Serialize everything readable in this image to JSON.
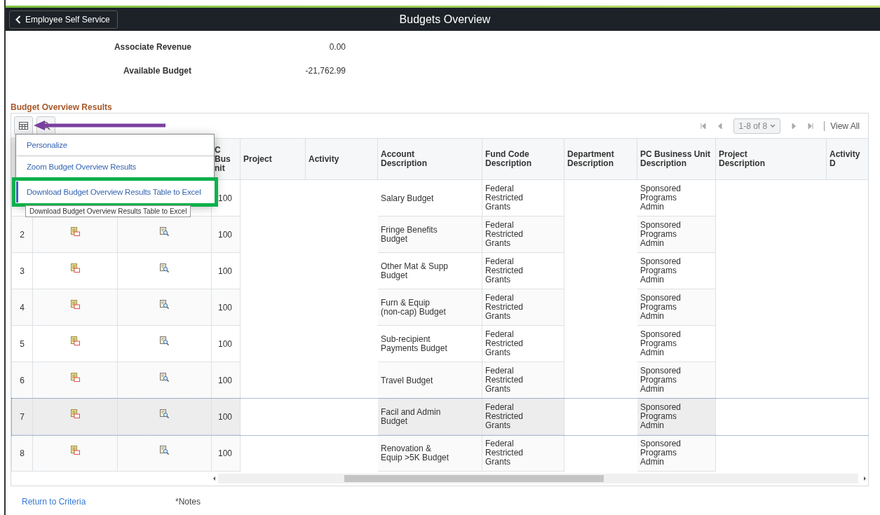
{
  "header": {
    "back_button": "Employee Self Service",
    "title": "Budgets Overview"
  },
  "summary": [
    {
      "label": "Associate Revenue",
      "value": "0.00"
    },
    {
      "label": "Available Budget",
      "value": "-21,762.99"
    }
  ],
  "grid": {
    "title": "Budget Overview Results",
    "menu": {
      "items": [
        {
          "label": "Personalize",
          "selected": false
        },
        {
          "label": "Zoom Budget Overview Results",
          "selected": false
        },
        {
          "label": "Download Budget Overview Results Table to Excel",
          "selected": true
        }
      ],
      "tooltip": "Download Budget Overview Results Table to Excel"
    },
    "pagination": {
      "range": "1-8 of 8",
      "view_all": "View All"
    },
    "columns": [
      {
        "label": "C Bus nit"
      },
      {
        "label": "Project"
      },
      {
        "label": "Activity"
      },
      {
        "label": "Account Description"
      },
      {
        "label": "Fund Code Description"
      },
      {
        "label": "Department Description"
      },
      {
        "label": "PC Business Unit Description"
      },
      {
        "label": "Project Description"
      },
      {
        "label": "Activity D"
      }
    ],
    "rows": [
      {
        "pc_bus_unit": "100",
        "account_description": "Salary Budget",
        "fund_code_description": "Federal Restricted Grants",
        "pc_business_unit_description": "Sponsored Programs Admin",
        "selected": false
      },
      {
        "number": "2",
        "pc_bus_unit": "100",
        "account_description": "Fringe Benefits Budget",
        "fund_code_description": "Federal Restricted Grants",
        "pc_business_unit_description": "Sponsored Programs Admin",
        "selected": false
      },
      {
        "number": "3",
        "pc_bus_unit": "100",
        "account_description": "Other Mat & Supp Budget",
        "fund_code_description": "Federal Restricted Grants",
        "pc_business_unit_description": "Sponsored Programs Admin",
        "selected": false
      },
      {
        "number": "4",
        "pc_bus_unit": "100",
        "account_description": "Furn & Equip (non-cap) Budget",
        "fund_code_description": "Federal Restricted Grants",
        "pc_business_unit_description": "Sponsored Programs Admin",
        "selected": false
      },
      {
        "number": "5",
        "pc_bus_unit": "100",
        "account_description": "Sub-recipient Payments Budget",
        "fund_code_description": "Federal Restricted Grants",
        "pc_business_unit_description": "Sponsored Programs Admin",
        "selected": false
      },
      {
        "number": "6",
        "pc_bus_unit": "100",
        "account_description": "Travel Budget",
        "fund_code_description": "Federal Restricted Grants",
        "pc_business_unit_description": "Sponsored Programs Admin",
        "selected": false
      },
      {
        "number": "7",
        "pc_bus_unit": "100",
        "account_description": "Facil and Admin Budget",
        "fund_code_description": "Federal Restricted Grants",
        "pc_business_unit_description": "Sponsored Programs Admin",
        "selected": true
      },
      {
        "number": "8",
        "pc_bus_unit": "100",
        "account_description": "Renovation & Equip >5K Budget",
        "fund_code_description": "Federal Restricted Grants",
        "pc_business_unit_description": "Sponsored Programs Admin",
        "selected": false
      }
    ]
  },
  "footer": {
    "return_link": "Return to Criteria",
    "notes": "*Notes"
  }
}
